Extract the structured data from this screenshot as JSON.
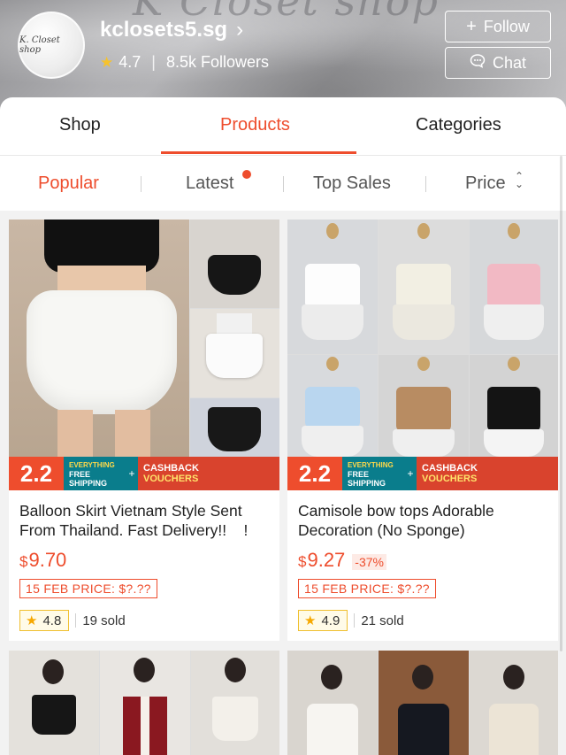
{
  "shop": {
    "avatar_text": "K. Closet shop",
    "name": "kclosets5.sg",
    "rating": "4.7",
    "followers": "8.5k Followers",
    "follow_label": "Follow",
    "chat_label": "Chat"
  },
  "tabs": [
    {
      "label": "Shop"
    },
    {
      "label": "Products"
    },
    {
      "label": "Categories"
    }
  ],
  "sort": {
    "popular": "Popular",
    "latest": "Latest",
    "top_sales": "Top Sales",
    "price": "Price"
  },
  "promo": {
    "badge": "2.2",
    "line1": "EVERYTHING",
    "line2": "FREE",
    "line3": "SHIPPING",
    "cash1": "CASHBACK",
    "cash2": "VOUCHERS"
  },
  "products": [
    {
      "title": "Balloon Skirt Vietnam Style Sent From Thailand. Fast Delivery!!    !",
      "currency": "$",
      "price": "9.70",
      "discount": "",
      "feb_price": "15 FEB PRICE: $?.??",
      "rating": "4.8",
      "sold": "19 sold"
    },
    {
      "title": "Camisole bow tops Adorable Decoration (No Sponge)",
      "currency": "$",
      "price": "9.27",
      "discount": "-37%",
      "feb_price": "15 FEB PRICE: $?.??",
      "rating": "4.9",
      "sold": "21 sold"
    }
  ],
  "colors": {
    "accent": "#ee4d2d",
    "star": "#f6c22c"
  },
  "icons": [
    "star-icon",
    "chevron-right-icon",
    "plus-icon",
    "chat-bubble-icon",
    "sort-arrows-icon"
  ]
}
